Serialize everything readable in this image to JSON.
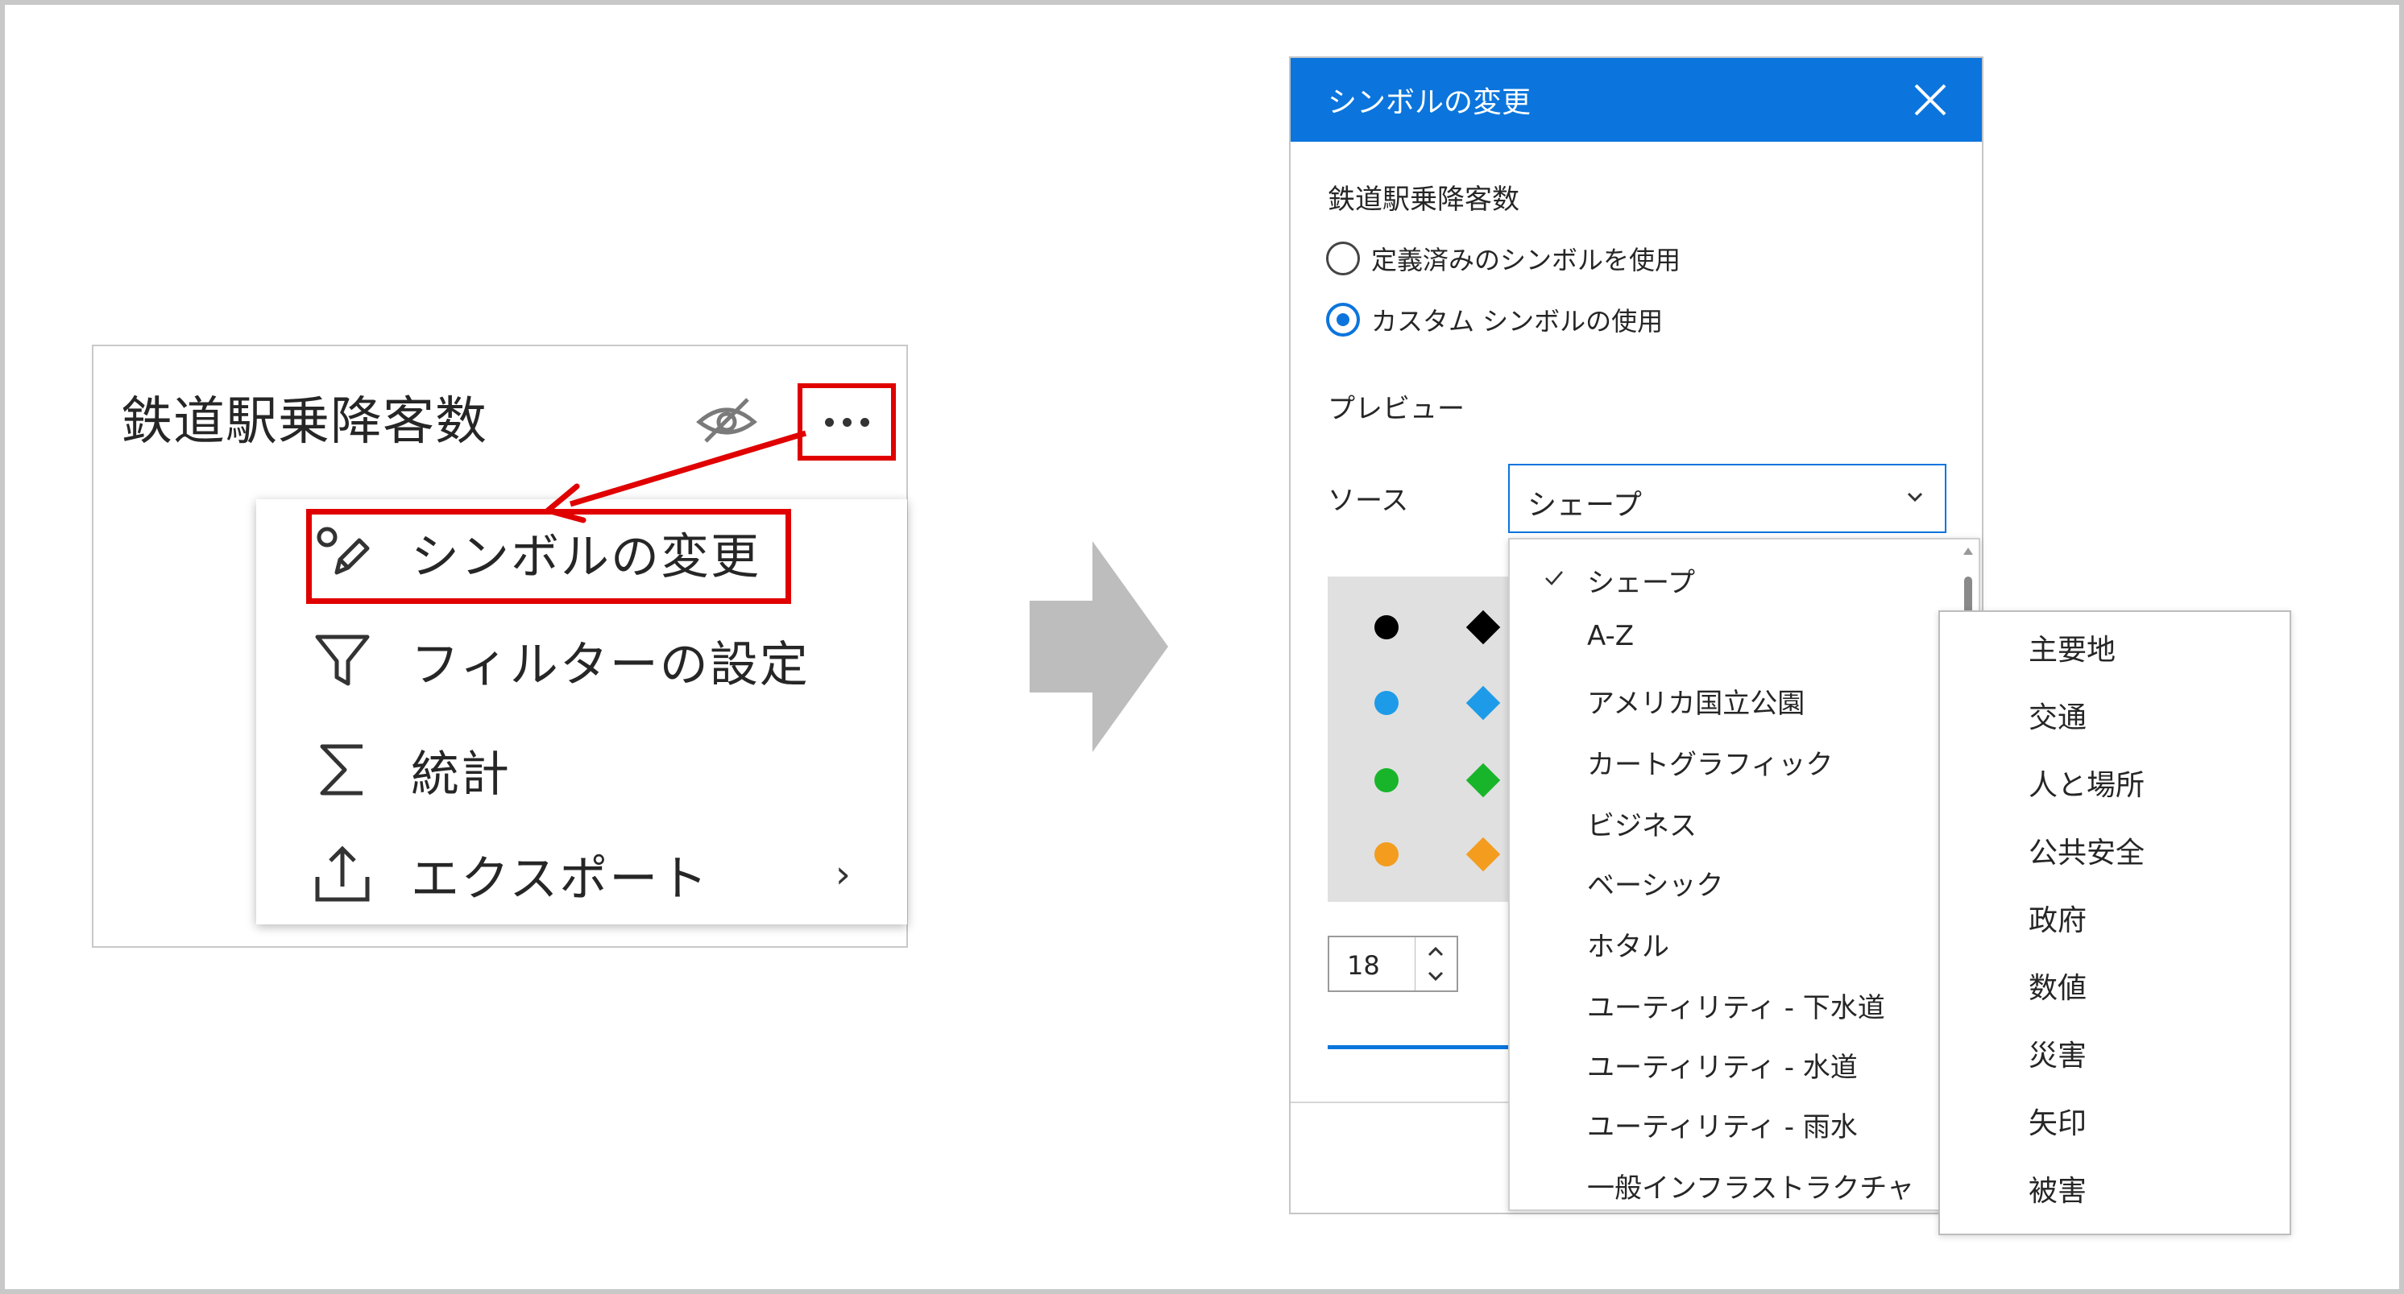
{
  "layer_menu": {
    "layer_title": "鉄道駅乗降客数",
    "items": [
      {
        "label": "シンボルの変更",
        "icon": "symbol-edit-icon"
      },
      {
        "label": "フィルターの設定",
        "icon": "filter-icon"
      },
      {
        "label": "統計",
        "icon": "sigma-icon"
      },
      {
        "label": "エクスポート",
        "icon": "export-icon",
        "chevron": "›"
      }
    ],
    "highlight_color": "#e00000"
  },
  "dialog": {
    "title": "シンボルの変更",
    "layer_name": "鉄道駅乗降客数",
    "radio_predefined": "定義済みのシンボルを使用",
    "radio_custom": "カスタム シンボルの使用",
    "selected_radio": "custom",
    "preview_label": "プレビュー",
    "source_label": "ソース",
    "source_value": "シェープ",
    "size_value": "18",
    "accent_color": "#0b75dd"
  },
  "preview_symbols": {
    "colors": [
      "#000000",
      "#1e9be8",
      "#18b52a",
      "#f39c1e"
    ],
    "shapes": [
      "circle-icon",
      "diamond-icon"
    ]
  },
  "source_options": [
    {
      "label": "シェープ",
      "checked": true
    },
    {
      "label": "A-Z"
    },
    {
      "label": "アメリカ国立公園"
    },
    {
      "label": "カートグラフィック"
    },
    {
      "label": "ビジネス"
    },
    {
      "label": "ベーシック"
    },
    {
      "label": "ホタル"
    },
    {
      "label": "ユーティリティ - 下水道"
    },
    {
      "label": "ユーティリティ - 水道"
    },
    {
      "label": "ユーティリティ - 雨水"
    },
    {
      "label": "一般インフラストラクチャ"
    }
  ],
  "submenu_options": [
    "主要地",
    "交通",
    "人と場所",
    "公共安全",
    "政府",
    "数値",
    "災害",
    "矢印",
    "被害"
  ]
}
